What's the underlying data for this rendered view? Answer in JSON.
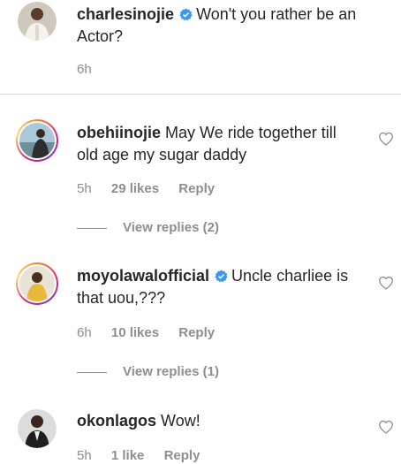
{
  "caption": {
    "username": "charlesinojie",
    "verified": true,
    "text": "Won't you rather be an Actor?",
    "time": "6h"
  },
  "comments": [
    {
      "username": "obehiinojie",
      "verified": false,
      "text": "May We ride together till old age my sugar daddy",
      "time": "5h",
      "likes": "29 likes",
      "reply_label": "Reply",
      "view_replies": "View replies (2)"
    },
    {
      "username": "moyolawalofficial",
      "verified": true,
      "text": "Uncle charliee is that uou,???",
      "time": "6h",
      "likes": "10 likes",
      "reply_label": "Reply",
      "view_replies": "View replies (1)"
    },
    {
      "username": "okonlagos",
      "verified": false,
      "text": "Wow!",
      "time": "5h",
      "likes": "1 like",
      "reply_label": "Reply"
    }
  ],
  "colors": {
    "verified_blue": "#3897f0",
    "secondary_text": "#8e8e8e",
    "primary_text": "#262626"
  }
}
